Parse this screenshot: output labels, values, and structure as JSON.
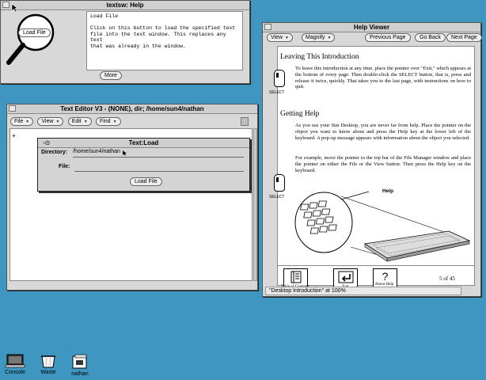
{
  "help_window": {
    "title": "textsw: Help",
    "button_label": "Load File",
    "help_text": "Load File\n\nClick on this button to load the specified text\nfile into the text window. This replaces any text\nthat was already in the window.",
    "more_button": "More"
  },
  "editor": {
    "title": "Text Editor V3 - (NONE), dir; /home/sun4/nathan",
    "menus": [
      "File",
      "View",
      "Edit",
      "Find"
    ],
    "caret": "+"
  },
  "load_popup": {
    "title": "Text:Load",
    "pin_glyph": "-⊙",
    "directory_label": "Directory:",
    "directory_value": "/home/sun4/nathan",
    "file_label": "File:",
    "file_value": "",
    "load_button": "Load File"
  },
  "viewer": {
    "title": "Help Viewer",
    "menus": [
      "View",
      "Magnify"
    ],
    "nav_buttons": [
      "Previous Page",
      "Go Back",
      "Next Page"
    ],
    "section1_title": "Leaving This Introduction",
    "section1_text": "To leave this introduction at any time, place the pointer over \"Exit,\" which appears at the bottom of every page. Then double-click the SELECT button, that is, press and release it twice, quickly. That takes you to the last page, with instructions on how to quit.",
    "select_caption": "SELECT",
    "section2_title": "Getting Help",
    "section2_text1": "As you use your Sun Desktop, you are never far from help. Place the pointer on the object you want to know about and press the Help key at the lower left of the keyboard. A pop-up message appears with information about the object you selected.",
    "section2_text2": "For example, move the pointer to the top bar of the File Manager window and place the pointer on either the File or the View button. Then press the Help key on the keyboard.",
    "select_caption2": "SELECT",
    "illustration_label": "Help",
    "toc_label": "Table of Contents",
    "exit_label": "Exit",
    "about_label": "About Help",
    "page_indicator": "5 of 45",
    "status_text": "\"Desktop Introduction\" at 100%"
  },
  "desktop_icons": [
    {
      "label": "Console",
      "icon": "console-icon"
    },
    {
      "label": "Waste",
      "icon": "wastebasket-icon"
    },
    {
      "label": "nathan",
      "icon": "home-folder-icon"
    }
  ]
}
